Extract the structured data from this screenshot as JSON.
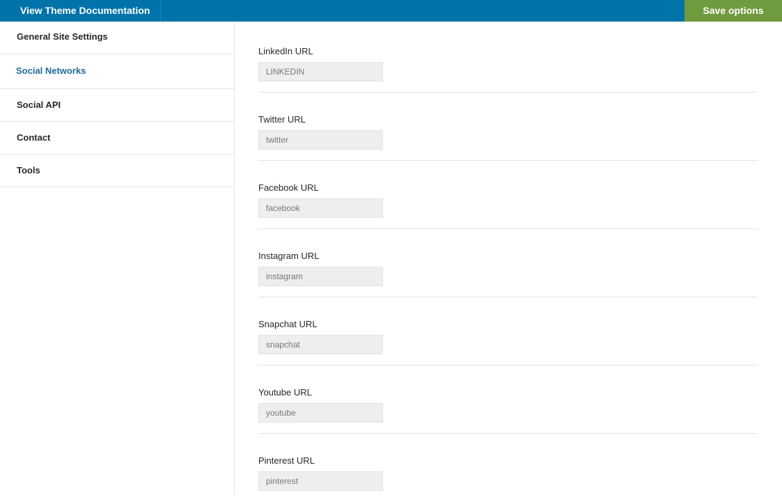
{
  "header": {
    "doc_link": "View Theme Documentation",
    "save_label": "Save options",
    "bar_color": "#0073aa",
    "save_color": "#6f9a3e"
  },
  "sidebar": {
    "items": [
      {
        "label": "General Site Settings",
        "active": false
      },
      {
        "label": "Social Networks",
        "active": true
      },
      {
        "label": "Social API",
        "active": false
      },
      {
        "label": "Contact",
        "active": false
      },
      {
        "label": "Tools",
        "active": false
      }
    ]
  },
  "fields": [
    {
      "label": "LinkedIn URL",
      "value": "LINKEDIN"
    },
    {
      "label": "Twitter URL",
      "value": "twitter"
    },
    {
      "label": "Facebook URL",
      "value": "facebook"
    },
    {
      "label": "Instagram URL",
      "value": "instagram"
    },
    {
      "label": "Snapchat URL",
      "value": "snapchat"
    },
    {
      "label": "Youtube URL",
      "value": "youtube"
    },
    {
      "label": "Pinterest URL",
      "value": "pinterest"
    }
  ]
}
